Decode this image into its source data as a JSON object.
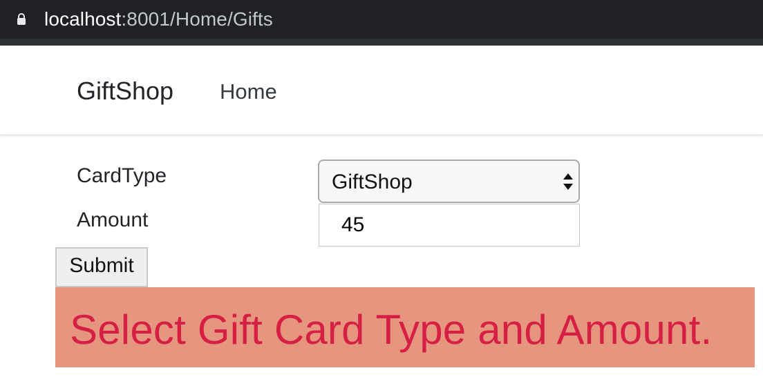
{
  "browser": {
    "url_host": "localhost",
    "url_rest": ":8001/Home/Gifts",
    "icons": {
      "lock": "lock-icon"
    }
  },
  "navbar": {
    "brand": "GiftShop",
    "links": [
      {
        "label": "Home"
      }
    ]
  },
  "form": {
    "card_type_label": "CardType",
    "card_type_selected": "GiftShop",
    "amount_label": "Amount",
    "amount_value": "45",
    "submit_label": "Submit",
    "icons": {
      "select_arrows": "up-down-chevron-icon"
    }
  },
  "message": {
    "text": "Select Gift Card Type and Amount.",
    "background_color": "#e6957e",
    "text_color": "#d61f45"
  }
}
